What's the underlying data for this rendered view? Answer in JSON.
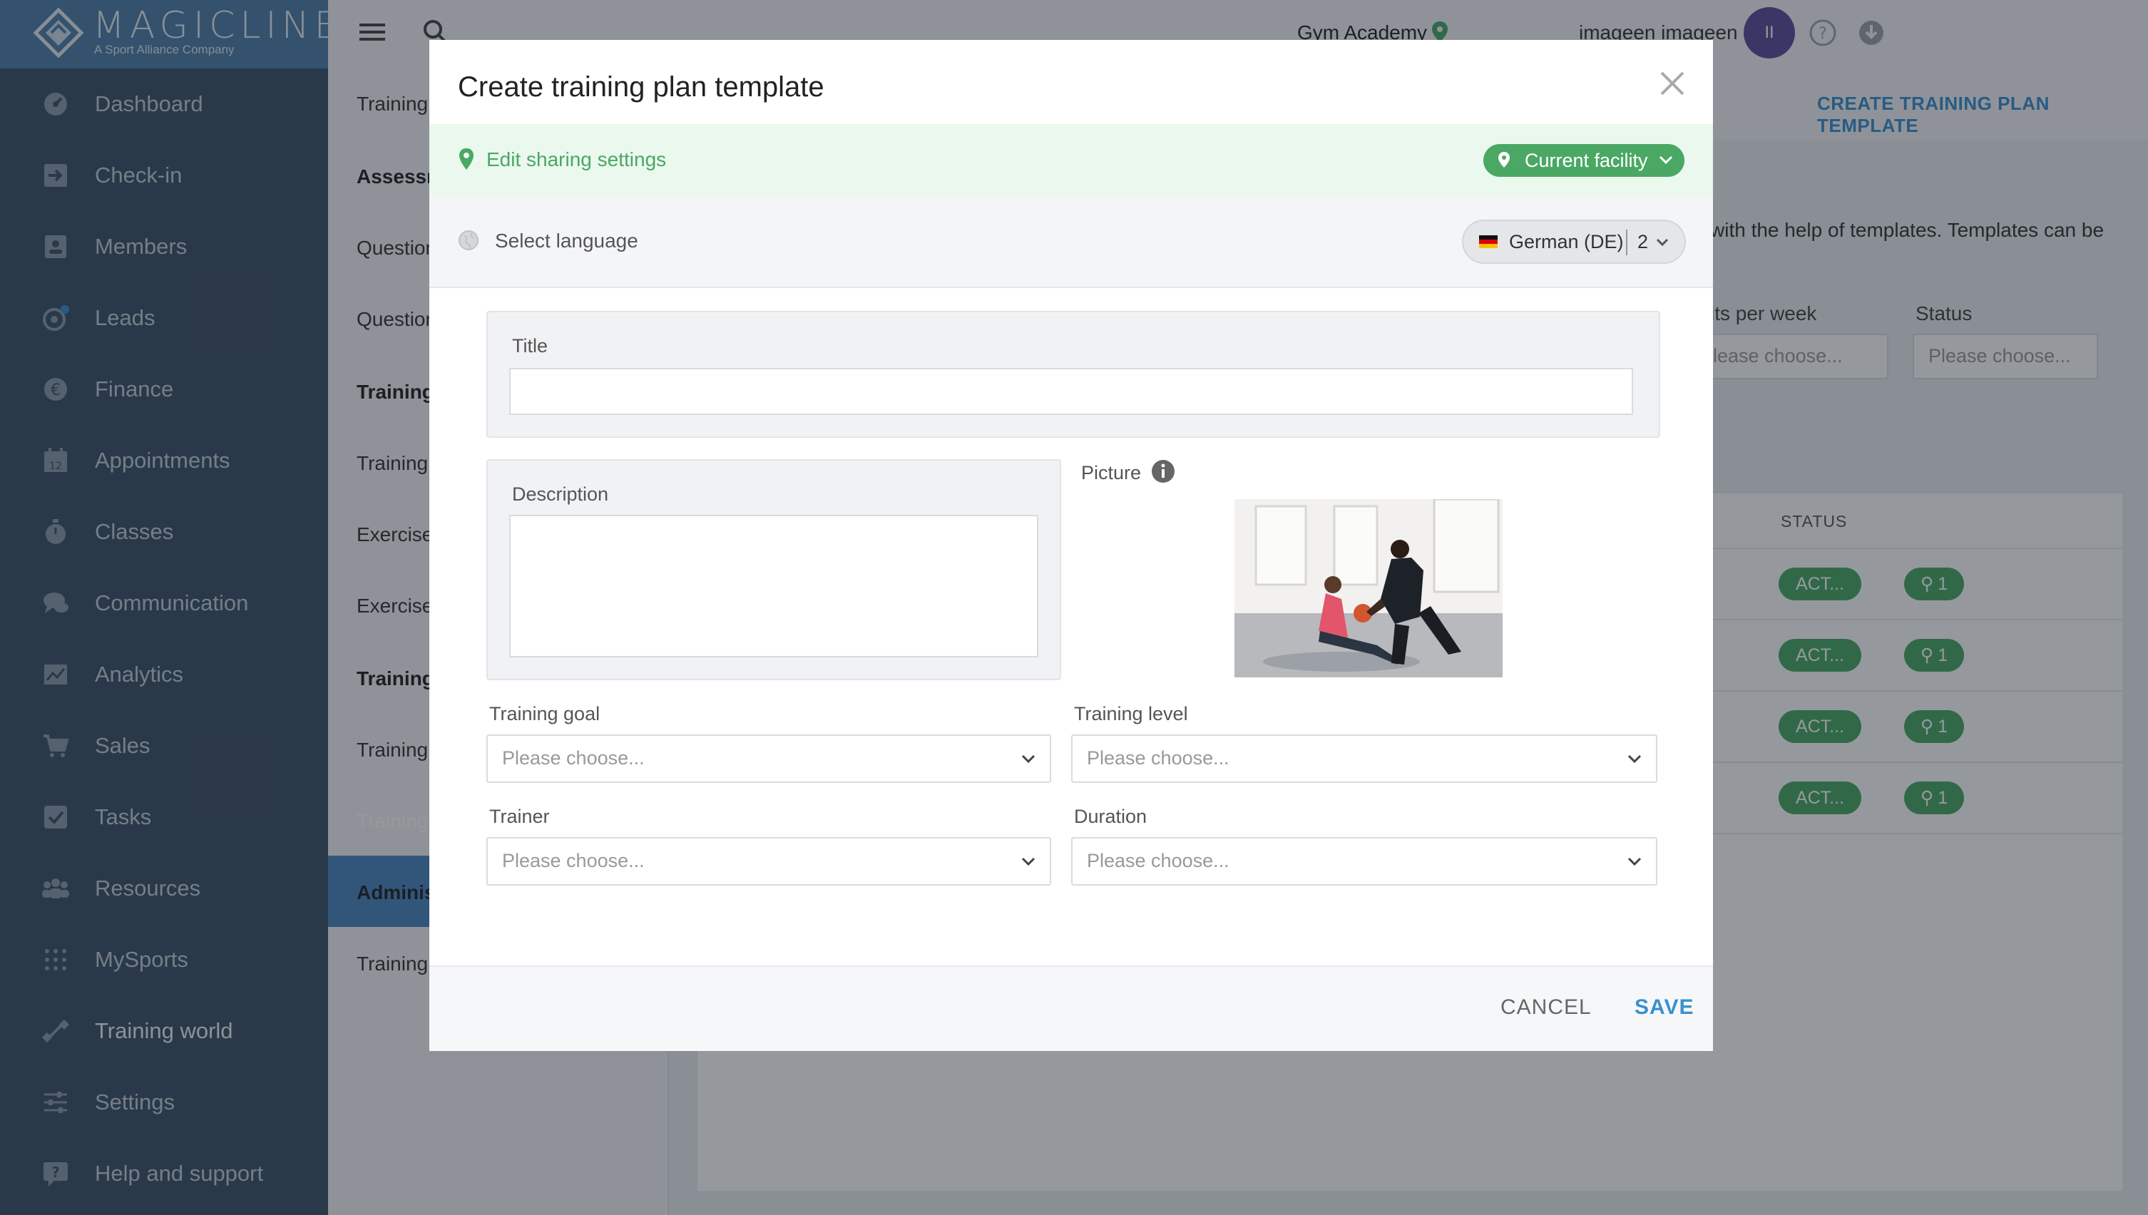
{
  "brand": {
    "name": "MAGICLINE",
    "tagline": "A Sport Alliance Company"
  },
  "sidebar": {
    "items": [
      {
        "label": "Dashboard",
        "icon": "dashboard-icon"
      },
      {
        "label": "Check-in",
        "icon": "checkin-icon"
      },
      {
        "label": "Members",
        "icon": "members-icon"
      },
      {
        "label": "Leads",
        "icon": "leads-icon"
      },
      {
        "label": "Finance",
        "icon": "finance-icon"
      },
      {
        "label": "Appointments",
        "icon": "calendar-icon"
      },
      {
        "label": "Classes",
        "icon": "stopwatch-icon"
      },
      {
        "label": "Communication",
        "icon": "chat-icon"
      },
      {
        "label": "Analytics",
        "icon": "chart-icon"
      },
      {
        "label": "Sales",
        "icon": "cart-icon"
      },
      {
        "label": "Tasks",
        "icon": "checkbox-icon"
      },
      {
        "label": "Resources",
        "icon": "group-icon"
      },
      {
        "label": "MySports",
        "icon": "dots-grid-icon"
      },
      {
        "label": "Training world",
        "icon": "dumbbell-icon"
      },
      {
        "label": "Settings",
        "icon": "sliders-icon"
      },
      {
        "label": "Help and support",
        "icon": "help-chat-icon"
      }
    ]
  },
  "header": {
    "facility": "Gym Academy",
    "username": "imageen imageen",
    "avatar_text": "II"
  },
  "subnav": {
    "items": [
      {
        "label": "Training",
        "bold": false
      },
      {
        "label": "Assessm",
        "bold": true
      },
      {
        "label": "Question",
        "bold": false
      },
      {
        "label": "Question",
        "bold": false
      },
      {
        "label": "Training",
        "bold": true
      },
      {
        "label": "Training",
        "bold": false
      },
      {
        "label": "Exercises",
        "bold": false
      },
      {
        "label": "Exercise",
        "bold": false
      },
      {
        "label": "Training",
        "bold": true
      },
      {
        "label": "Training",
        "bold": false
      },
      {
        "label": "Training",
        "bold": false
      },
      {
        "label": "Administ",
        "bold": true
      },
      {
        "label": "Training",
        "bold": false
      }
    ]
  },
  "page": {
    "create_link": "CREATE TRAINING PLAN TEMPLATE",
    "intro_text": "with the help of templates. Templates can be",
    "filters": [
      {
        "label": "its per week",
        "placeholder": "lease choose..."
      },
      {
        "label": "Status",
        "placeholder": "Please choose..."
      }
    ],
    "table_header_status": "STATUS",
    "rows": [
      {
        "status": "ACT...",
        "locations": "1"
      },
      {
        "status": "ACT...",
        "locations": "1"
      },
      {
        "status": "ACT...",
        "locations": "1"
      },
      {
        "status": "ACT...",
        "locations": "1"
      }
    ]
  },
  "modal": {
    "title": "Create training plan template",
    "sharing_link": "Edit sharing settings",
    "facility_pill": "Current facility",
    "language_label": "Select language",
    "language_selected": "German (DE)",
    "language_count": "2",
    "title_label": "Title",
    "title_value": "",
    "description_label": "Description",
    "description_value": "",
    "picture_label": "Picture",
    "training_goal_label": "Training goal",
    "training_goal_placeholder": "Please choose...",
    "training_level_label": "Training level",
    "training_level_placeholder": "Please choose...",
    "trainer_label": "Trainer",
    "trainer_placeholder": "Please choose...",
    "duration_label": "Duration",
    "duration_placeholder": "Please choose...",
    "cancel_label": "CANCEL",
    "save_label": "SAVE"
  },
  "colors": {
    "sidebar_bg": "#3d5166",
    "brand_blue": "#4f7ea8",
    "accent_blue": "#3a8fd0",
    "success_green": "#4aa864",
    "avatar_purple": "#5c4b9b"
  }
}
